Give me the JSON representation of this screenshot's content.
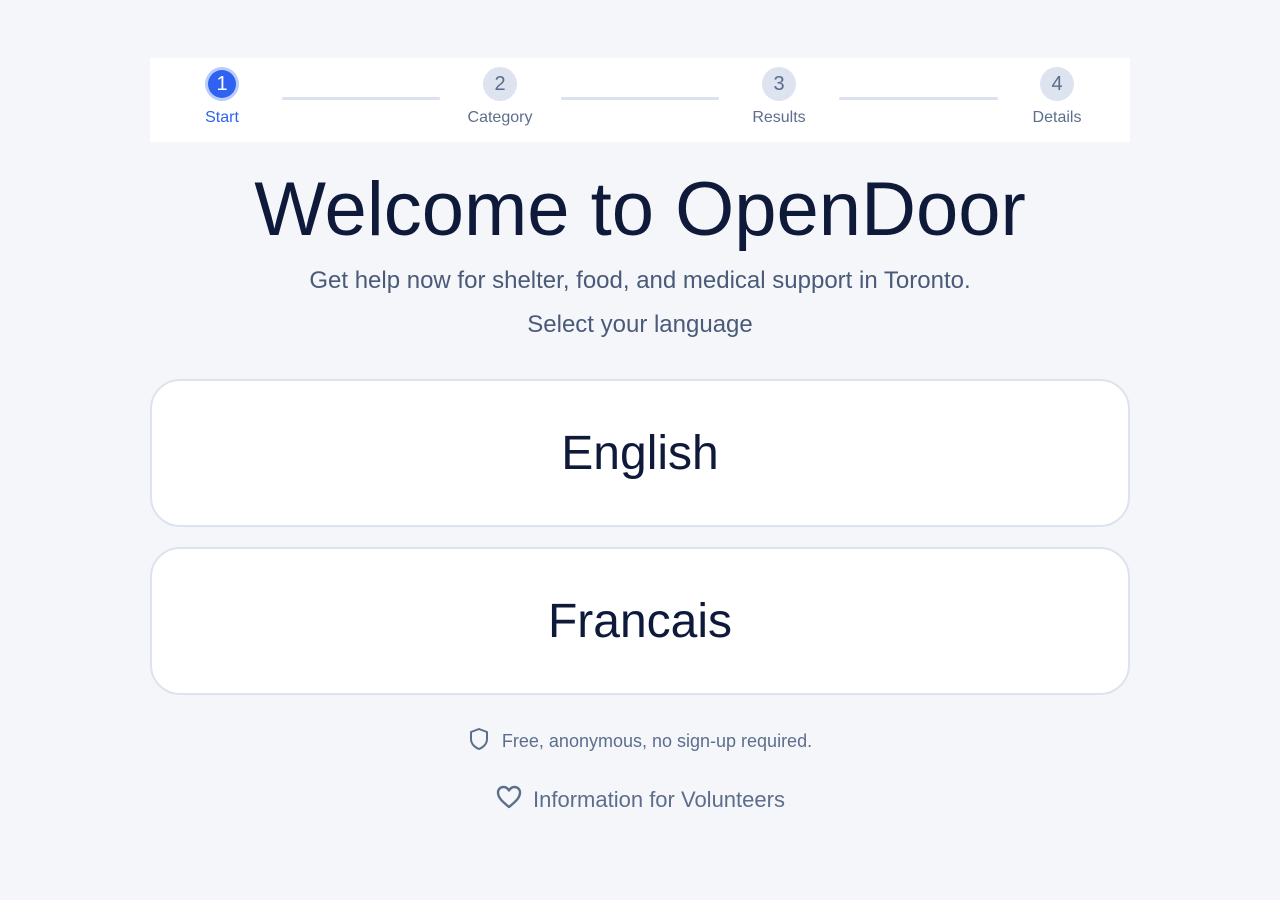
{
  "stepper": {
    "steps": [
      {
        "number": "1",
        "label": "Start",
        "state": "active"
      },
      {
        "number": "2",
        "label": "Category",
        "state": "inactive"
      },
      {
        "number": "3",
        "label": "Results",
        "state": "inactive"
      },
      {
        "number": "4",
        "label": "Details",
        "state": "inactive"
      }
    ]
  },
  "header": {
    "title": "Welcome to OpenDoor",
    "subtitle": "Get help now for shelter, food, and medical support in Toronto.",
    "language_prompt": "Select your language"
  },
  "languages": {
    "english": "English",
    "french": "Francais"
  },
  "footer": {
    "privacy_text": "Free, anonymous, no sign-up required.",
    "privacy_icon": "shield-icon",
    "volunteers_link": "Information for Volunteers",
    "volunteers_icon": "heart-icon"
  },
  "colors": {
    "accent": "#2f62f0",
    "background": "#f4f6fa",
    "text_dark": "#0f1a3a",
    "text_muted": "#5d6e8d"
  }
}
